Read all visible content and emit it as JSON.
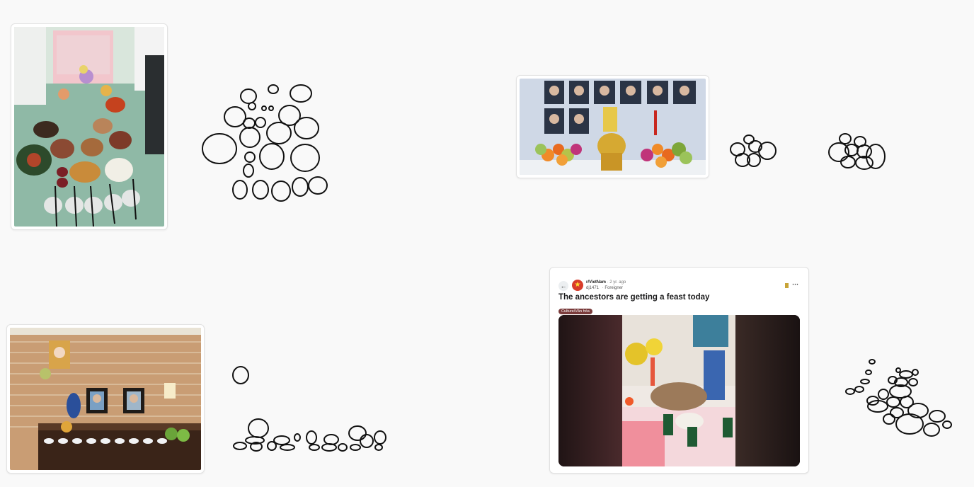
{
  "post": {
    "subreddit": "r/VietNam",
    "age": "· 2 yr. ago",
    "username": "dj1471",
    "user_flair": "· Foreigner",
    "title": "The ancestors are getting a feast today",
    "flair": "Culture/Văn hóa",
    "avatar_star": "★"
  },
  "colors": {
    "accent_red": "#d83b2a",
    "flair_bg": "#7a3b3b",
    "bookmark": "#c8a438",
    "canvas": "#f9f9f9"
  },
  "icons": {
    "back": "back-arrow-icon",
    "more": "more-options-icon",
    "bookmark": "bookmark-icon"
  }
}
